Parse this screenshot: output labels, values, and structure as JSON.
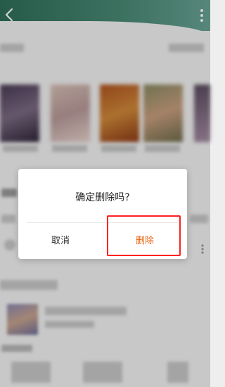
{
  "dialog": {
    "title": "确定删除吗?",
    "cancel_label": "取消",
    "delete_label": "删除"
  },
  "colors": {
    "accent_delete": "#e8650f",
    "highlight": "#ff2020",
    "header": "#2f6f5a"
  },
  "icons": {
    "back": "chevron-left-icon",
    "more": "more-vertical-icon"
  }
}
